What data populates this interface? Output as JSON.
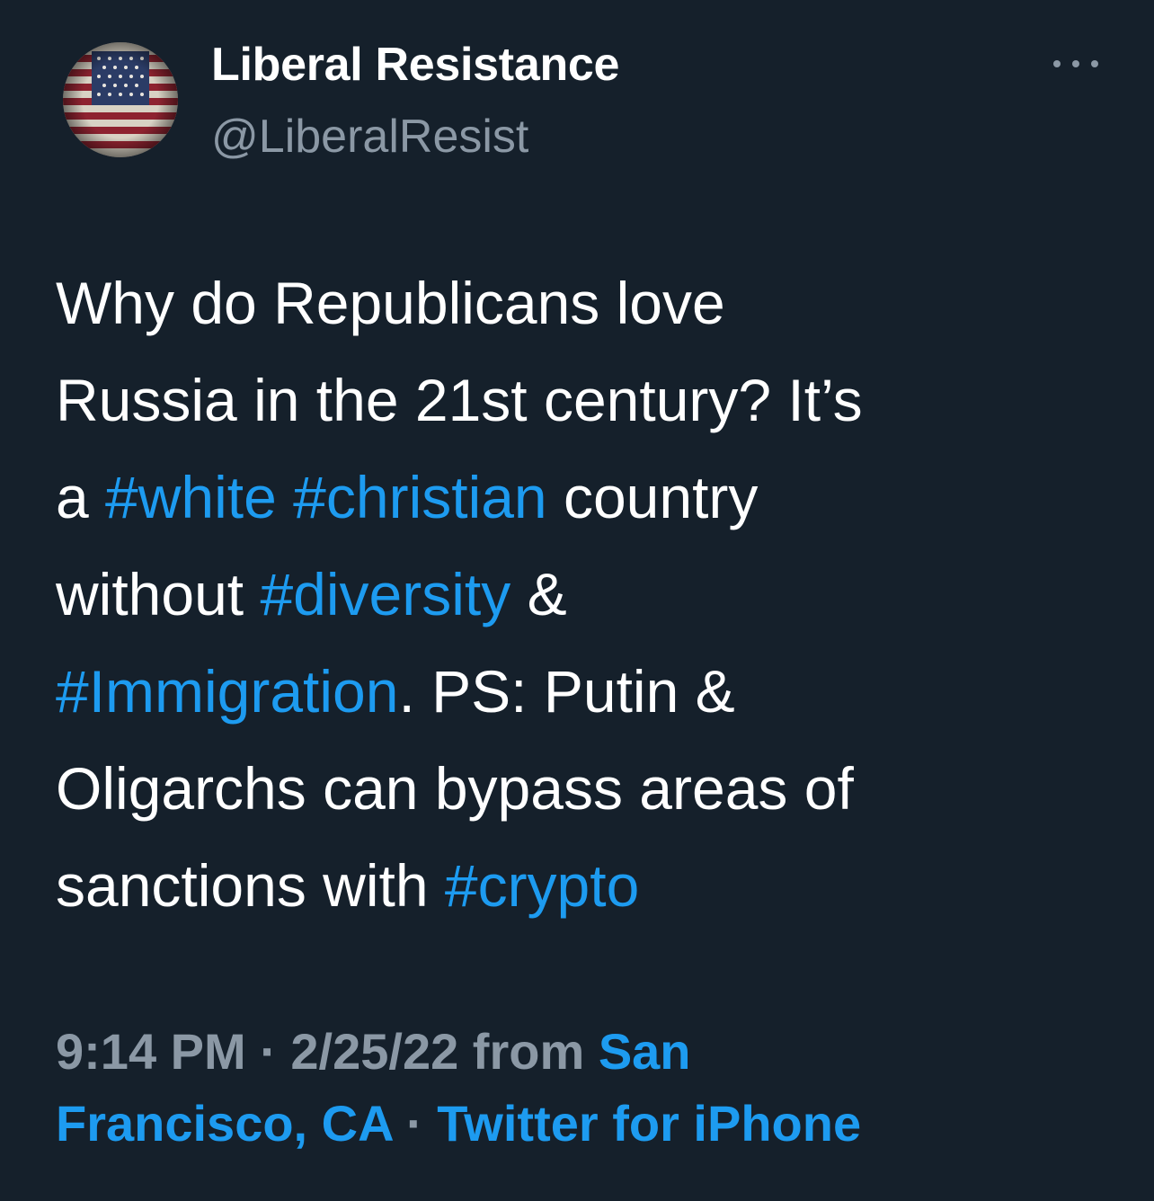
{
  "author": {
    "display_name": "Liberal Resistance",
    "handle": "@LiberalResist",
    "avatar_icon": "us-flag-avatar-icon"
  },
  "more_icon": "more-options-icon",
  "tweet": {
    "lines": [
      [
        {
          "t": "Why do Republicans love",
          "tag": false
        }
      ],
      [
        {
          "t": "Russia in the 21st century? It’s",
          "tag": false
        }
      ],
      [
        {
          "t": "a ",
          "tag": false
        },
        {
          "t": "#white",
          "tag": true
        },
        {
          "t": " ",
          "tag": false
        },
        {
          "t": "#christian",
          "tag": true
        },
        {
          "t": " country",
          "tag": false
        }
      ],
      [
        {
          "t": "without ",
          "tag": false
        },
        {
          "t": "#diversity",
          "tag": true
        },
        {
          "t": " &",
          "tag": false
        }
      ],
      [
        {
          "t": "#Immigration",
          "tag": true
        },
        {
          "t": ". PS: Putin &",
          "tag": false
        }
      ],
      [
        {
          "t": "Oligarchs can bypass areas of",
          "tag": false
        }
      ],
      [
        {
          "t": "sanctions with ",
          "tag": false
        },
        {
          "t": "#crypto",
          "tag": true
        }
      ]
    ]
  },
  "meta": {
    "time": "9:14 PM",
    "sep1": " · ",
    "date": "2/25/22",
    "from": " from ",
    "location_part1": "San",
    "location_part2": "Francisco, CA",
    "sep2": " · ",
    "source": "Twitter for iPhone"
  },
  "colors": {
    "background": "#15202b",
    "text": "#ffffff",
    "secondary": "#8b98a5",
    "accent": "#1d9bf0"
  }
}
